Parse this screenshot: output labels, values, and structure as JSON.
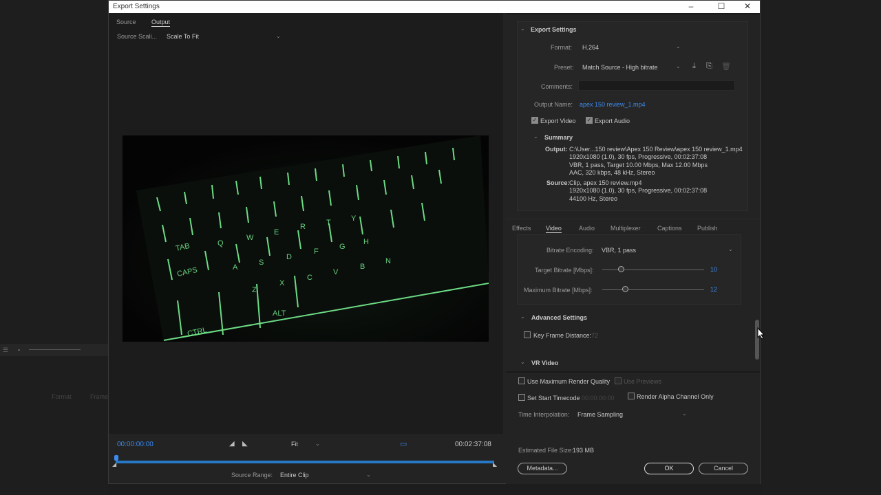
{
  "window": {
    "title": "Export Settings"
  },
  "left": {
    "tabs": [
      "Source",
      "Output"
    ],
    "source_scaling_label": "Source Scali...",
    "source_scaling_value": "Scale To Fit"
  },
  "timeline": {
    "start": "00:00:00:00",
    "end": "00:02:37:08",
    "zoom": "Fit",
    "source_range_label": "Source Range:",
    "source_range_value": "Entire Clip"
  },
  "export_settings": {
    "header": "Export Settings",
    "format_label": "Format:",
    "format_value": "H.264",
    "preset_label": "Preset:",
    "preset_value": "Match Source - High bitrate",
    "comments_label": "Comments:",
    "output_name_label": "Output Name:",
    "output_name_value": "apex 150 review_1.mp4",
    "export_video": "Export Video",
    "export_audio": "Export Audio"
  },
  "summary": {
    "header": "Summary",
    "output_label": "Output:",
    "output_lines": [
      "C:\\User...150 review\\Apex 150 Review\\apex 150 review_1.mp4",
      "1920x1080 (1.0), 30 fps, Progressive, 00:02:37:08",
      "VBR, 1 pass, Target 10.00 Mbps, Max 12.00 Mbps",
      "AAC, 320 kbps, 48 kHz, Stereo"
    ],
    "source_label": "Source:",
    "source_lines": [
      "Clip, apex 150 review.mp4",
      "1920x1080 (1.0), 30 fps, Progressive, 00:02:37:08",
      "44100 Hz, Stereo"
    ]
  },
  "settings_tabs": [
    "Effects",
    "Video",
    "Audio",
    "Multiplexer",
    "Captions",
    "Publish"
  ],
  "video": {
    "bitrate_encoding_label": "Bitrate Encoding:",
    "bitrate_encoding_value": "VBR, 1 pass",
    "target_bitrate_label": "Target Bitrate [Mbps]:",
    "target_bitrate_value": "10",
    "max_bitrate_label": "Maximum Bitrate [Mbps]:",
    "max_bitrate_value": "12",
    "advanced_header": "Advanced Settings",
    "key_frame_label": "Key Frame Distance:",
    "key_frame_value": "72",
    "vr_header": "VR Video"
  },
  "bottom": {
    "max_render_quality": "Use Maximum Render Quality",
    "use_previews": "Use Previews",
    "set_start_timecode": "Set Start Timecode",
    "start_timecode_value": "00:00:00:00",
    "render_alpha": "Render Alpha Channel Only",
    "time_interp_label": "Time Interpolation:",
    "time_interp_value": "Frame Sampling",
    "file_size_label": "Estimated File Size:",
    "file_size_value": "193 MB",
    "metadata_button": "Metadata...",
    "ok_button": "OK",
    "cancel_button": "Cancel"
  },
  "background": {
    "format_col": "Format",
    "frame_col": "Frame"
  },
  "colors": {
    "accent": "#3b8bf0",
    "keyboard_glow": "#7dff9a"
  }
}
